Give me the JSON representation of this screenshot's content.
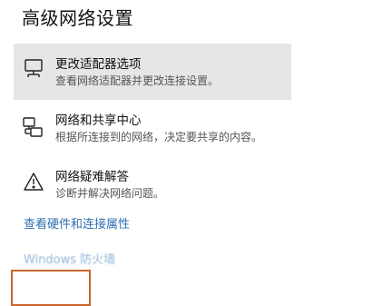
{
  "page": {
    "title": "高级网络设置"
  },
  "options": [
    {
      "icon": "network-adapter-icon",
      "label": "更改适配器选项",
      "description": "查看网络适配器并更改连接设置。"
    },
    {
      "icon": "sharing-center-icon",
      "label": "网络和共享中心",
      "description": "根据所连接到的网络，决定要共享的内容。"
    },
    {
      "icon": "warning-icon",
      "label": "网络疑难解答",
      "description": "诊断并解决网络问题。"
    }
  ],
  "links": {
    "hardware": "查看硬件和连接属性",
    "firewall": "Windows 防火墙"
  },
  "colors": {
    "link": "#2f6fb3",
    "hover_bg": "#e6e6e6",
    "highlight_border": "#c9662f"
  }
}
